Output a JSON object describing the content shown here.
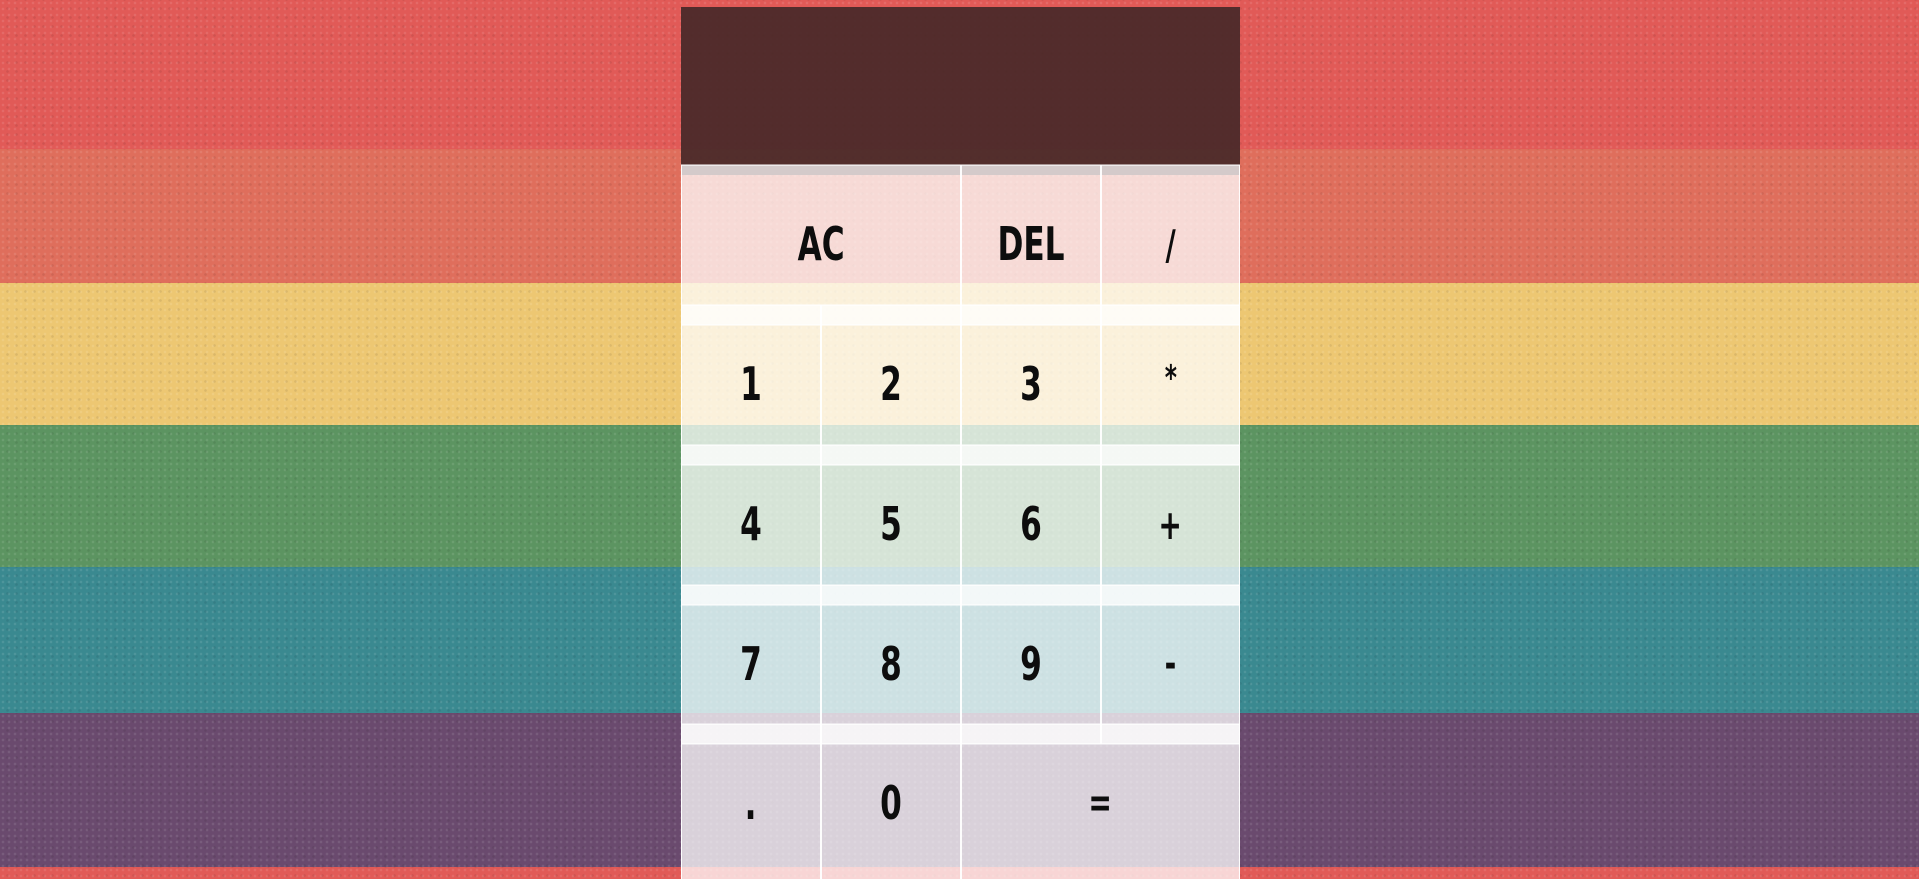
{
  "background": {
    "stripes": [
      "#e15a57",
      "#df6e5c",
      "#edc772",
      "#5c9461",
      "#3a8990",
      "#6a4a6e"
    ]
  },
  "display": {
    "previous_operand": "",
    "current_operand": ""
  },
  "keys": {
    "clear": "AC",
    "delete": "DEL",
    "divide": "/",
    "one": "1",
    "two": "2",
    "three": "3",
    "multiply": "*",
    "four": "4",
    "five": "5",
    "six": "6",
    "plus": "+",
    "seven": "7",
    "eight": "8",
    "nine": "9",
    "minus": "-",
    "decimal": ".",
    "zero": "0",
    "equals": "="
  }
}
